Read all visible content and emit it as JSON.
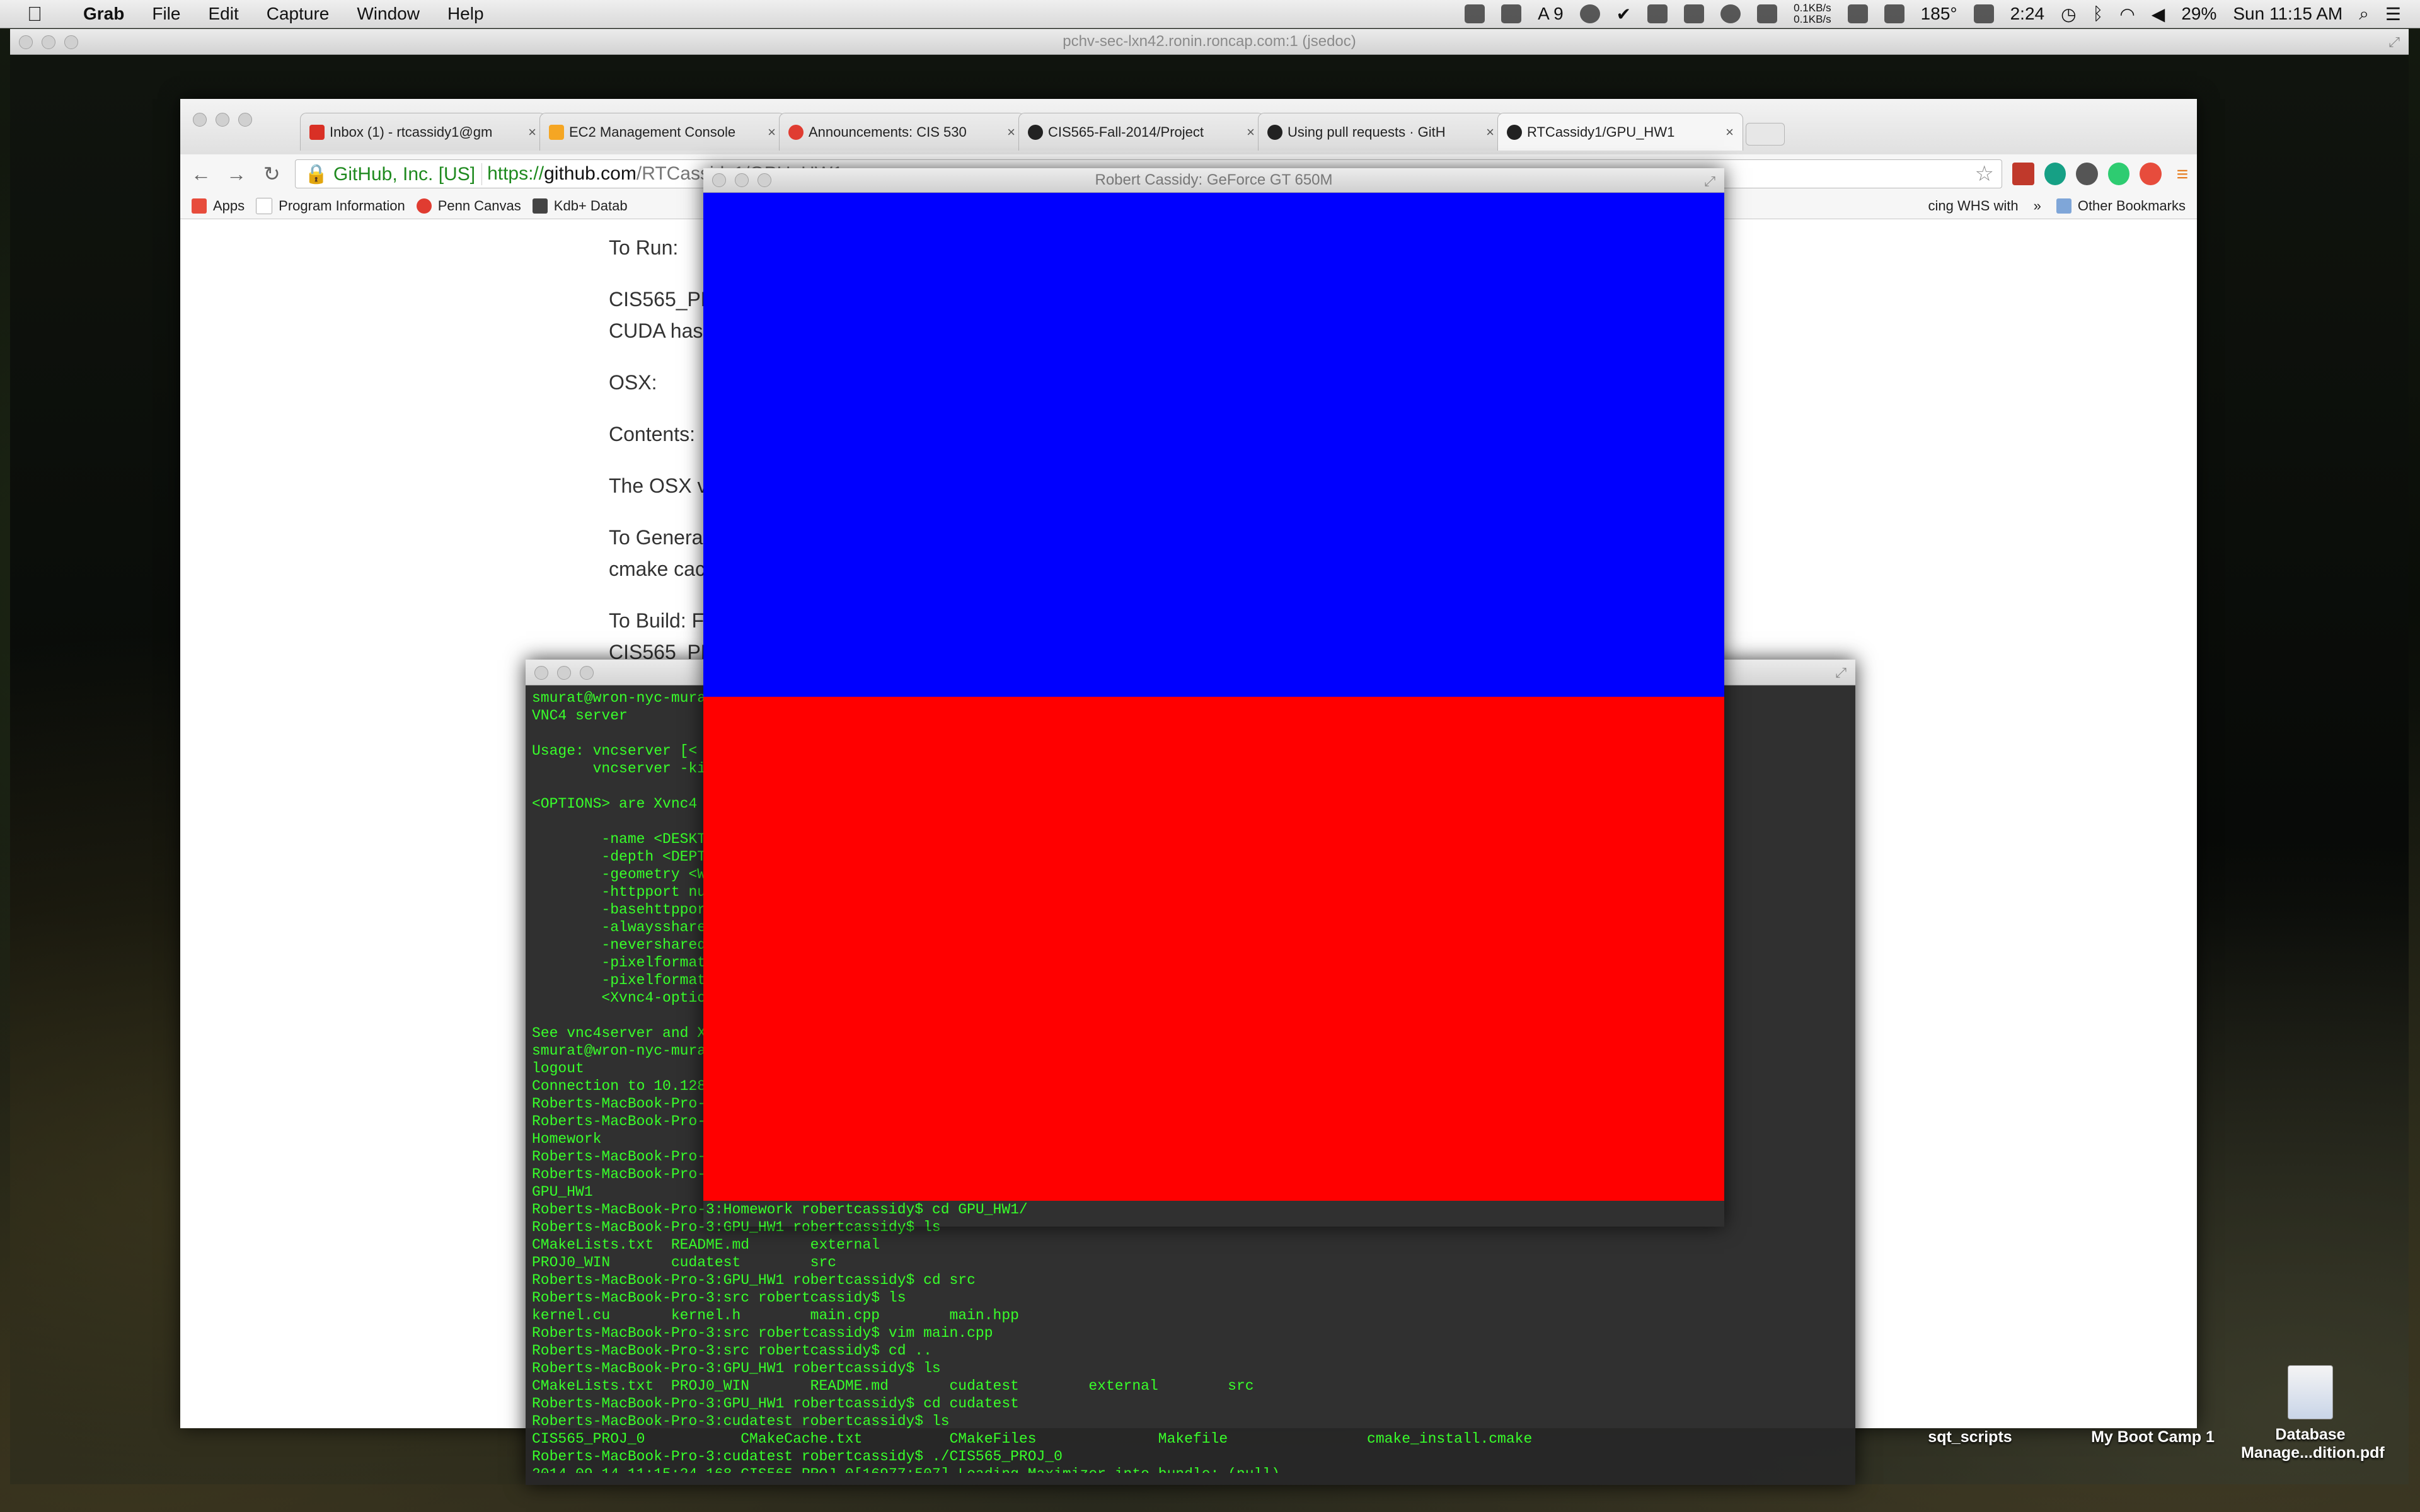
{
  "menubar": {
    "items": [
      "Grab",
      "File",
      "Edit",
      "Capture",
      "Window",
      "Help"
    ],
    "net_up": "0.1KB/s",
    "net_down": "0.1KB/s",
    "temperature": "185°",
    "battery_time": "2:24",
    "battery_percent": "29%",
    "clock": "Sun 11:15 AM",
    "badge_count": "9"
  },
  "vnc": {
    "title": "pchv-sec-lxn42.ronin.roncap.com:1 (jsedoc)"
  },
  "chrome": {
    "tabs": [
      {
        "label": "Inbox (1) - rtcassidy1@gm",
        "icon": "gmail-icon",
        "color": "#d93025"
      },
      {
        "label": "EC2 Management Console",
        "icon": "aws-icon",
        "color": "#f5a623"
      },
      {
        "label": "Announcements: CIS 530",
        "icon": "canvas-icon",
        "color": "#e03c31"
      },
      {
        "label": "CIS565-Fall-2014/Project",
        "icon": "github-icon",
        "color": "#222222"
      },
      {
        "label": "Using pull requests · GitH",
        "icon": "github-icon",
        "color": "#222222"
      },
      {
        "label": "RTCassidy1/GPU_HW1",
        "icon": "github-icon",
        "color": "#222222"
      }
    ],
    "ev_badge": "GitHub, Inc. [US]",
    "url_scheme": "https://",
    "url_host": "github.com",
    "url_path": "/RTCassidy1/GPU_HW1",
    "bookmarks": [
      "Apps",
      "Program Information",
      "Penn Canvas",
      "Kdb+ Datab"
    ],
    "bookmark_partial": "cing WHS with",
    "other_bookmarks": "Other Bookmarks",
    "readme": [
      "To Run:",
      "CIS565_PR",
      "CUDA has",
      "OSX:",
      "Contents:",
      "The OSX v",
      "To Genera",
      "cmake cac",
      "To Build: F",
      "CIS565_PR"
    ]
  },
  "gl_window": {
    "title": "Robert Cassidy: GeForce GT 650M",
    "top_color": "#0000ff",
    "bottom_color": "#ff0000"
  },
  "terminal": {
    "lines": [
      "smurat@wron-nyc-mura",
      "VNC4 server",
      "",
      "Usage: vncserver [<",
      "       vncserver -ki",
      "",
      "<OPTIONS> are Xvnc4",
      "",
      "        -name <DESKT",
      "        -depth <DEPT",
      "        -geometry <W",
      "        -httpport nu",
      "        -basehttppor",
      "        -alwaysshare",
      "        -nevershared",
      "        -pixelformat",
      "        -pixelformat",
      "        <Xvnc4-optio",
      "",
      "See vnc4server and X",
      "smurat@wron-nyc-mura",
      "logout",
      "Connection to 10.128",
      "Roberts-MacBook-Pro-",
      "Roberts-MacBook-Pro-",
      "Homework",
      "Roberts-MacBook-Pro-",
      "Roberts-MacBook-Pro-",
      "GPU_HW1",
      "Roberts-MacBook-Pro-3:Homework robertcassidy$ cd GPU_HW1/",
      "Roberts-MacBook-Pro-3:GPU_HW1 robertcassidy$ ls",
      "CMakeLists.txt  README.md       external",
      "PROJ0_WIN       cudatest        src",
      "Roberts-MacBook-Pro-3:GPU_HW1 robertcassidy$ cd src",
      "Roberts-MacBook-Pro-3:src robertcassidy$ ls",
      "kernel.cu       kernel.h        main.cpp        main.hpp",
      "Roberts-MacBook-Pro-3:src robertcassidy$ vim main.cpp",
      "Roberts-MacBook-Pro-3:src robertcassidy$ cd ..",
      "Roberts-MacBook-Pro-3:GPU_HW1 robertcassidy$ ls",
      "CMakeLists.txt  PROJ0_WIN       README.md       cudatest        external        src",
      "Roberts-MacBook-Pro-3:GPU_HW1 robertcassidy$ cd cudatest",
      "Roberts-MacBook-Pro-3:cudatest robertcassidy$ ls",
      "CIS565_PROJ_0           CMakeCache.txt          CMakeFiles              Makefile                cmake_install.cmake",
      "Roberts-MacBook-Pro-3:cudatest robertcassidy$ ./CIS565_PROJ_0",
      "2014-09-14 11:15:24.168 CIS565_PROJ_0[16977:507] Loading Maximizer into bundle: (null)"
    ]
  },
  "desktop_icons": [
    "sqt_scripts",
    "My Boot Camp 1",
    "Database Manage...dition.pdf"
  ]
}
